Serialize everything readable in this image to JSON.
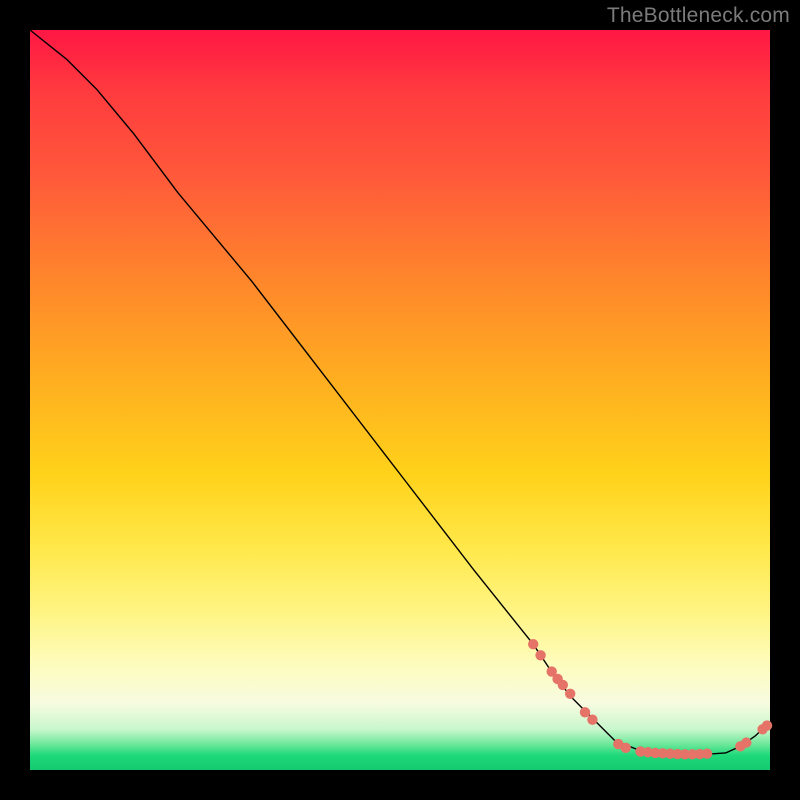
{
  "watermark": "TheBottleneck.com",
  "chart_data": {
    "type": "line",
    "title": "",
    "xlabel": "",
    "ylabel": "",
    "xlim": [
      0,
      100
    ],
    "ylim": [
      0,
      100
    ],
    "grid": false,
    "legend": false,
    "annotations_note": "No axis ticks, labels, or legend visible; values estimated from pixel geometry on a 0–100 scale.",
    "series": [
      {
        "name": "curve",
        "x": [
          0,
          5,
          9,
          14,
          20,
          30,
          40,
          50,
          60,
          68,
          70,
          73,
          76,
          79,
          82,
          85,
          88,
          91,
          94,
          96,
          98,
          100
        ],
        "y": [
          100,
          96,
          92,
          86,
          78,
          66,
          53,
          40,
          27,
          17,
          14,
          10,
          7,
          4,
          2.8,
          2.3,
          2.1,
          2.1,
          2.3,
          3.2,
          4.6,
          6.5
        ]
      }
    ],
    "markers": {
      "name": "highlight-points",
      "color": "#e57368",
      "points": [
        {
          "x": 68.0,
          "y": 17.0
        },
        {
          "x": 69.0,
          "y": 15.5
        },
        {
          "x": 70.5,
          "y": 13.3
        },
        {
          "x": 71.3,
          "y": 12.3
        },
        {
          "x": 72.0,
          "y": 11.5
        },
        {
          "x": 73.0,
          "y": 10.3
        },
        {
          "x": 75.0,
          "y": 7.8
        },
        {
          "x": 76.0,
          "y": 6.8
        },
        {
          "x": 79.5,
          "y": 3.5
        },
        {
          "x": 80.5,
          "y": 3.0
        },
        {
          "x": 82.5,
          "y": 2.5
        },
        {
          "x": 83.5,
          "y": 2.4
        },
        {
          "x": 84.5,
          "y": 2.3
        },
        {
          "x": 85.5,
          "y": 2.25
        },
        {
          "x": 86.5,
          "y": 2.2
        },
        {
          "x": 87.5,
          "y": 2.15
        },
        {
          "x": 88.5,
          "y": 2.12
        },
        {
          "x": 89.5,
          "y": 2.12
        },
        {
          "x": 90.5,
          "y": 2.15
        },
        {
          "x": 91.5,
          "y": 2.2
        },
        {
          "x": 96.0,
          "y": 3.2
        },
        {
          "x": 96.8,
          "y": 3.7
        },
        {
          "x": 99.0,
          "y": 5.5
        },
        {
          "x": 99.6,
          "y": 6.0
        }
      ]
    }
  }
}
